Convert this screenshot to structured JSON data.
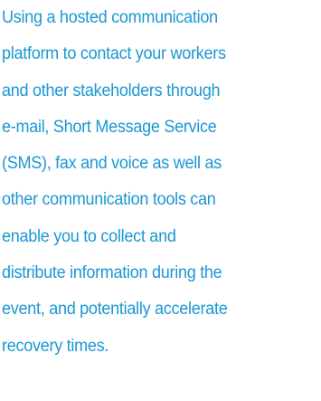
{
  "document": {
    "text_color": "#1b97d3",
    "lines": [
      "Using a hosted communication",
      "platform to contact your workers",
      "and other stakeholders through",
      "e-mail, Short Message Service",
      "(SMS), fax and voice as well as",
      "other communication tools can",
      "enable you to collect and",
      "distribute information during the",
      "event, and potentially accelerate",
      "recovery times."
    ]
  }
}
